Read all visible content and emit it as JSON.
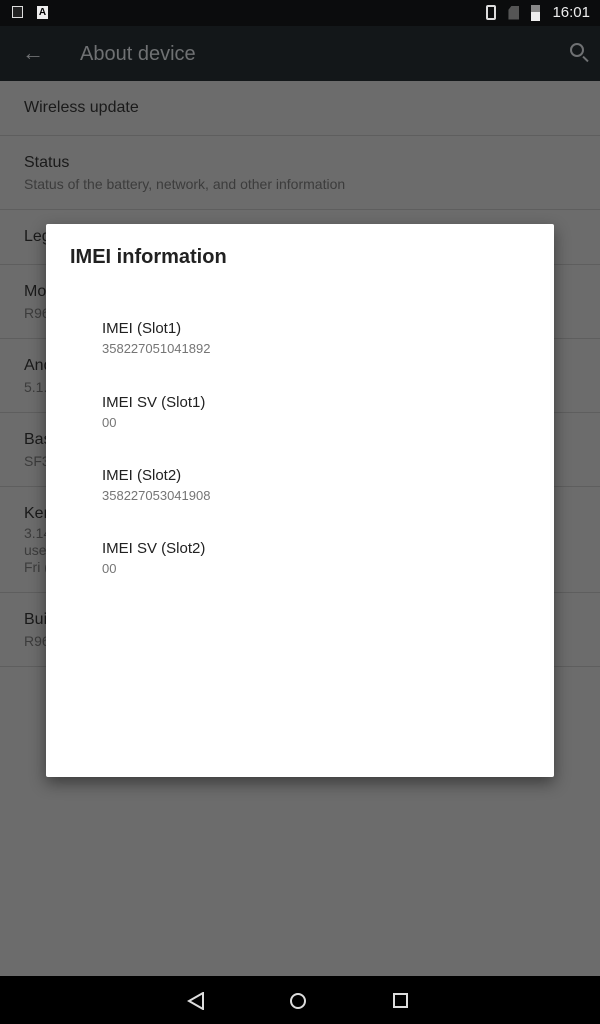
{
  "status_bar": {
    "time": "16:01",
    "icons": [
      "image-notification-icon",
      "a-notification-icon",
      "vibrate-icon",
      "no-sim-icon",
      "battery-icon"
    ]
  },
  "app_bar": {
    "title": "About device",
    "back_icon": "arrow-left-icon",
    "search_icon": "search-icon"
  },
  "settings": [
    {
      "title": "Wireless update"
    },
    {
      "title": "Status",
      "subtitle": "Status of the battery, network, and other information"
    },
    {
      "title": "Leg"
    },
    {
      "title": "Mo",
      "subtitle": "R96"
    },
    {
      "title": "And",
      "subtitle": "5.1."
    },
    {
      "title": "Bas",
      "subtitle": "SF3"
    },
    {
      "title": "Ker",
      "subtitle": "3.14",
      "subtitle2": "use",
      "subtitle3": "Fri ("
    },
    {
      "title": "Bui",
      "subtitle": "R96"
    }
  ],
  "dialog": {
    "title": "IMEI information",
    "items": [
      {
        "label": "IMEI (Slot1)",
        "value": "358227051041892"
      },
      {
        "label": "IMEI SV (Slot1)",
        "value": "00"
      },
      {
        "label": "IMEI (Slot2)",
        "value": "358227053041908"
      },
      {
        "label": "IMEI SV (Slot2)",
        "value": "00"
      }
    ]
  }
}
